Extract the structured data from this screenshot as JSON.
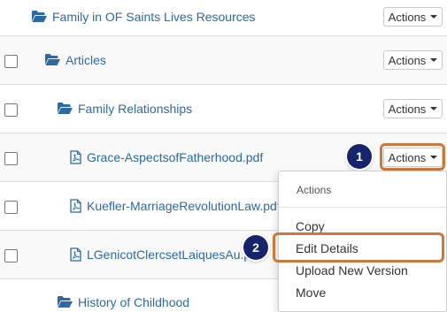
{
  "rows": [
    {
      "name": "Family in OF Saints Lives Resources",
      "type": "folder"
    },
    {
      "name": "Articles",
      "type": "folder"
    },
    {
      "name": "Family Relationships",
      "type": "folder"
    },
    {
      "name": "Grace-AspectsofFatherhood.pdf",
      "type": "pdf"
    },
    {
      "name": "Kuefler-MarriageRevolutionLaw.pdf",
      "type": "pdf"
    },
    {
      "name": "LGenicotClercsetLaiquesAu.pdf",
      "type": "pdf"
    },
    {
      "name": "History of Childhood",
      "type": "folder"
    }
  ],
  "actions_label": "Actions",
  "menu": {
    "header": "Actions",
    "items": [
      "Copy",
      "Edit Details",
      "Upload New Version",
      "Move"
    ]
  },
  "callouts": [
    "1",
    "2"
  ],
  "colors": {
    "link": "#2b6aa6",
    "highlight": "#c8793b",
    "callout": "#15246b"
  }
}
